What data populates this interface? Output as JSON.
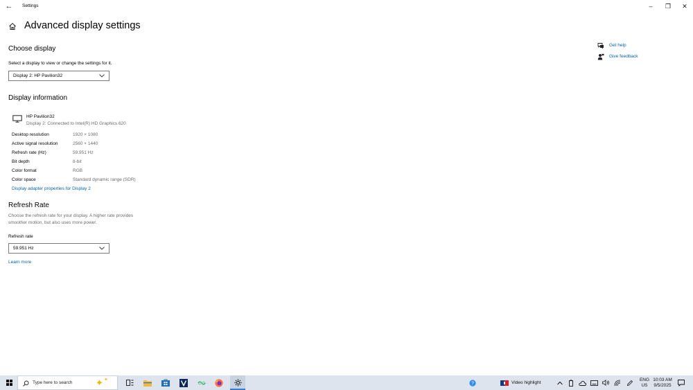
{
  "window": {
    "title": "Settings",
    "controls": {
      "minimize": "–",
      "restore": "❐",
      "close": "✕"
    }
  },
  "header": {
    "title": "Advanced display settings"
  },
  "choose_display": {
    "heading": "Choose display",
    "description": "Select a display to view or change the settings for it.",
    "selected": "Display 2: HP Pavilion32"
  },
  "display_info": {
    "heading": "Display information",
    "monitor_name": "HP Pavilion32",
    "monitor_subtitle": "Display 2: Connected to Intel(R) HD Graphics 620",
    "rows": [
      {
        "label": "Desktop resolution",
        "value": "1920 × 1080"
      },
      {
        "label": "Active signal resolution",
        "value": "2560 × 1440"
      },
      {
        "label": "Refresh rate (Hz)",
        "value": "59.951 Hz"
      },
      {
        "label": "Bit depth",
        "value": "8-bit"
      },
      {
        "label": "Color format",
        "value": "RGB"
      },
      {
        "label": "Color space",
        "value": "Standard dynamic range (SDR)"
      }
    ],
    "adapter_link": "Display adapter properties for Display 2"
  },
  "refresh": {
    "heading": "Refresh Rate",
    "description_line1": "Choose the refresh rate for your display. A higher rate provides",
    "description_line2": "smoother motion, but also uses more power.",
    "field_label": "Refresh rate",
    "selected": "59.951 Hz",
    "learn_more": "Learn more"
  },
  "right_rail": {
    "get_help": "Get help",
    "give_feedback": "Give feedback"
  },
  "taskbar": {
    "search_placeholder": "Type here to search",
    "video_highlight": "Video highlight",
    "lang_line1": "ENG",
    "lang_line2": "US",
    "time": "10:03 AM",
    "date": "9/5/2025"
  },
  "colors": {
    "accent": "#0063b1",
    "taskbar": "#dde4ee",
    "muted_text": "#6b6b6b"
  },
  "icons": [
    "back-arrow-icon",
    "home-icon",
    "monitor-icon",
    "chevron-down-icon",
    "get-help-icon",
    "give-feedback-icon",
    "windows-start-icon",
    "search-icon",
    "task-view-icon",
    "file-explorer-icon",
    "store-icon",
    "settings-gear-icon",
    "firefox-icon",
    "network-icon",
    "volume-icon",
    "notifications-icon"
  ]
}
